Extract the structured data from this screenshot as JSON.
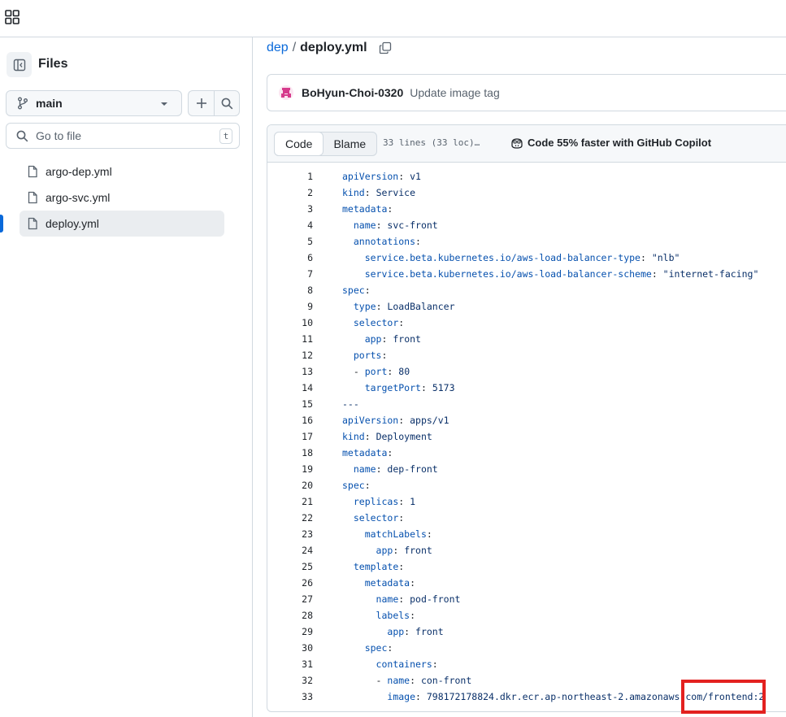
{
  "topbar": {
    "apps_icon": "grid-apps-icon"
  },
  "sidebar": {
    "title": "Files",
    "branch": "main",
    "goto_placeholder": "Go to file",
    "goto_shortcut": "t",
    "files": [
      "argo-dep.yml",
      "argo-svc.yml",
      "deploy.yml"
    ],
    "selected_file": "deploy.yml"
  },
  "breadcrumb": {
    "repo": "dep",
    "sep": "/",
    "file": "deploy.yml"
  },
  "commit": {
    "author": "BoHyun-Choi-0320",
    "message": "Update image tag"
  },
  "file_header": {
    "tab_code": "Code",
    "tab_blame": "Blame",
    "meta": "33 lines (33 loc)…",
    "copilot": "Code 55% faster with GitHub Copilot"
  },
  "code_lines": [
    {
      "n": "1",
      "key": "apiVersion",
      "val": " v1"
    },
    {
      "n": "2",
      "key": "kind",
      "val": " Service"
    },
    {
      "n": "3",
      "key": "metadata",
      "val": ""
    },
    {
      "n": "4",
      "key": "  name",
      "val": " svc-front"
    },
    {
      "n": "5",
      "key": "  annotations",
      "val": ""
    },
    {
      "n": "6",
      "key": "    service.beta.kubernetes.io/aws-load-balancer-type",
      "val": " \"nlb\""
    },
    {
      "n": "7",
      "key": "    service.beta.kubernetes.io/aws-load-balancer-scheme",
      "val": " \"internet-facing\""
    },
    {
      "n": "8",
      "key": "spec",
      "val": ""
    },
    {
      "n": "9",
      "key": "  type",
      "val": " LoadBalancer"
    },
    {
      "n": "10",
      "key": "  selector",
      "val": ""
    },
    {
      "n": "11",
      "key": "    app",
      "val": " front"
    },
    {
      "n": "12",
      "key": "  ports",
      "val": ""
    },
    {
      "n": "13",
      "key": "  - port",
      "val": " 80"
    },
    {
      "n": "14",
      "key": "    targetPort",
      "val": " 5173"
    },
    {
      "n": "15",
      "key": "",
      "val": "---"
    },
    {
      "n": "16",
      "key": "apiVersion",
      "val": " apps/v1"
    },
    {
      "n": "17",
      "key": "kind",
      "val": " Deployment"
    },
    {
      "n": "18",
      "key": "metadata",
      "val": ""
    },
    {
      "n": "19",
      "key": "  name",
      "val": " dep-front"
    },
    {
      "n": "20",
      "key": "spec",
      "val": ""
    },
    {
      "n": "21",
      "key": "  replicas",
      "val": " 1"
    },
    {
      "n": "22",
      "key": "  selector",
      "val": ""
    },
    {
      "n": "23",
      "key": "    matchLabels",
      "val": ""
    },
    {
      "n": "24",
      "key": "      app",
      "val": " front"
    },
    {
      "n": "25",
      "key": "  template",
      "val": ""
    },
    {
      "n": "26",
      "key": "    metadata",
      "val": ""
    },
    {
      "n": "27",
      "key": "      name",
      "val": " pod-front"
    },
    {
      "n": "28",
      "key": "      labels",
      "val": ""
    },
    {
      "n": "29",
      "key": "        app",
      "val": " front"
    },
    {
      "n": "30",
      "key": "    spec",
      "val": ""
    },
    {
      "n": "31",
      "key": "      containers",
      "val": ""
    },
    {
      "n": "32",
      "key": "      - name",
      "val": " con-front"
    },
    {
      "n": "33",
      "key": "        image",
      "val": " 798172178824.dkr.ecr.ap-northeast-2.amazonaws.com/frontend:2"
    }
  ],
  "colors": {
    "accent": "#0969da",
    "annotation_box": "#e3211f",
    "yaml_key": "#0550ae"
  }
}
